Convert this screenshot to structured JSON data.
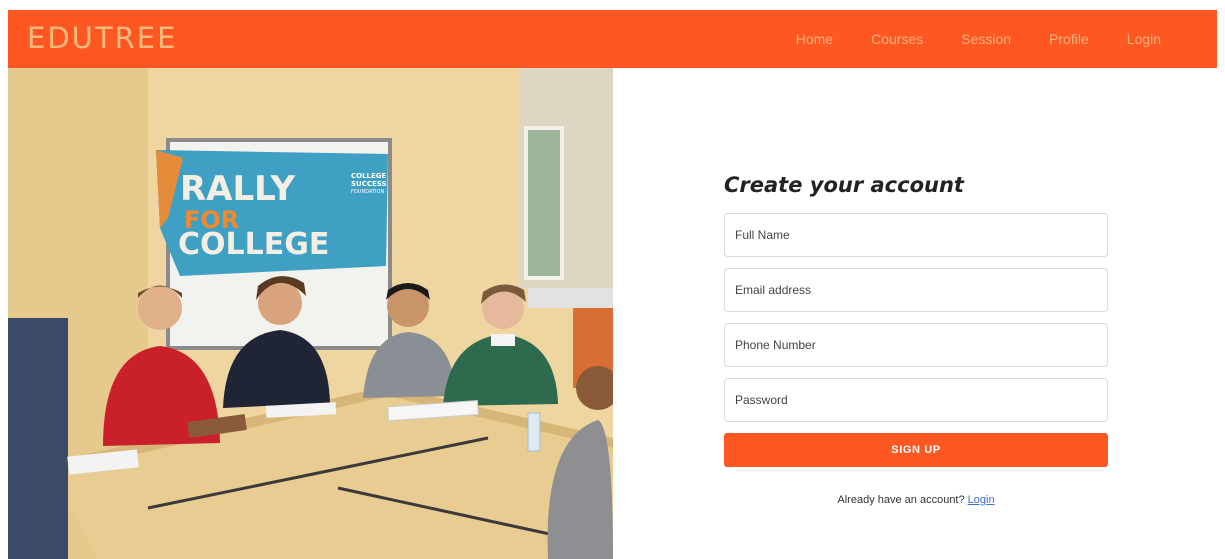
{
  "navbar": {
    "brand": "EDUTREE",
    "links": [
      "Home",
      "Courses",
      "Session",
      "Profile",
      "Login"
    ]
  },
  "photo": {
    "banner_line1": "RALLY",
    "banner_line2": "FOR",
    "banner_line3": "COLLEGE",
    "banner_org1": "COLLEGE",
    "banner_org2": "SUCCESS",
    "banner_org3": "FOUNDATION"
  },
  "form": {
    "title": "Create your account",
    "fullname_placeholder": "Full Name",
    "email_placeholder": "Email address",
    "phone_placeholder": "Phone Number",
    "password_placeholder": "Password",
    "submit_label": "SIGN UP",
    "already_text": "Already have an account?",
    "login_link": "Login"
  },
  "colors": {
    "accent": "#fe5722",
    "nav_text": "#f6b27a",
    "link": "#3b6fd8"
  }
}
